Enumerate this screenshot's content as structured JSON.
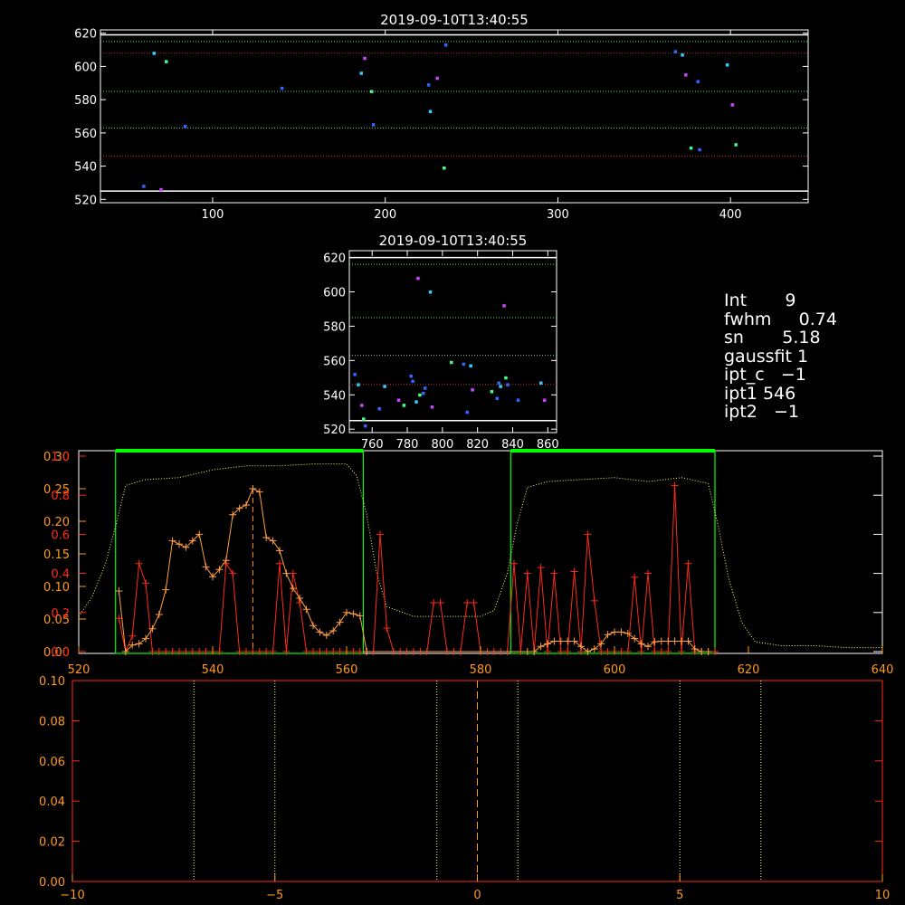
{
  "colors": {
    "background": "#000000",
    "axis_white": "#ffffff",
    "axis_red": "#ff2a1a",
    "axis_orange": "#ff9a1a",
    "data_red": "#ff2a1a",
    "data_orange": "#ffa040",
    "green_band": "#00ff00",
    "guide_green": "#66dd66",
    "guide_red": "#cc3333",
    "guide_yellow": "#ffff66",
    "points_blue": "#3366ff",
    "points_cyan": "#33ccff",
    "points_magenta": "#cc44ff",
    "points_green": "#44ff88"
  },
  "info_panel": [
    {
      "key": "Int",
      "value": "9"
    },
    {
      "key": "fwhm",
      "value": "0.74"
    },
    {
      "key": "sn",
      "value": "5.18"
    },
    {
      "key": "gaussfit",
      "value": "1"
    },
    {
      "key": "ipt_c",
      "value": "−1"
    },
    {
      "key": "ipt1",
      "value": "546"
    },
    {
      "key": "ipt2",
      "value": "−1"
    }
  ],
  "chart_data": [
    {
      "type": "scatter",
      "title": "2019-09-10T13:40:55",
      "xlim": [
        35,
        445
      ],
      "ylim": [
        518,
        622
      ],
      "x_ticks": [
        100,
        200,
        300,
        400
      ],
      "y_ticks": [
        520,
        540,
        560,
        580,
        600,
        620
      ],
      "hlines_white": [
        619,
        525
      ],
      "hlines_green_dotted": [
        615,
        585,
        563
      ],
      "hlines_red_dotted": [
        608,
        546
      ],
      "points": [
        [
          60,
          528
        ],
        [
          66,
          608
        ],
        [
          70,
          526
        ],
        [
          73,
          603
        ],
        [
          84,
          564
        ],
        [
          140,
          587
        ],
        [
          186,
          596
        ],
        [
          188,
          605
        ],
        [
          192,
          585
        ],
        [
          193,
          565
        ],
        [
          225,
          589
        ],
        [
          226,
          573
        ],
        [
          230,
          593
        ],
        [
          234,
          539
        ],
        [
          235,
          613
        ],
        [
          368,
          609
        ],
        [
          372,
          607
        ],
        [
          374,
          595
        ],
        [
          377,
          551
        ],
        [
          381,
          591
        ],
        [
          382,
          550
        ],
        [
          398,
          601
        ],
        [
          401,
          577
        ],
        [
          403,
          553
        ]
      ]
    },
    {
      "type": "scatter",
      "title": "2019-09-10T13:40:55",
      "xlim": [
        747,
        865
      ],
      "ylim": [
        518,
        624
      ],
      "x_ticks": [
        760,
        780,
        800,
        820,
        840,
        860
      ],
      "y_ticks": [
        520,
        540,
        560,
        580,
        600,
        620
      ],
      "hlines_white": [
        620,
        525
      ],
      "hlines_green_dotted": [
        616,
        585,
        563
      ],
      "hlines_red_dotted": [
        546
      ],
      "points": [
        [
          750,
          552
        ],
        [
          752,
          546
        ],
        [
          754,
          534
        ],
        [
          755,
          526
        ],
        [
          756,
          522
        ],
        [
          764,
          532
        ],
        [
          767,
          545
        ],
        [
          775,
          537
        ],
        [
          778,
          534
        ],
        [
          782,
          551
        ],
        [
          783,
          548
        ],
        [
          785,
          536
        ],
        [
          786,
          608
        ],
        [
          787,
          540
        ],
        [
          789,
          541
        ],
        [
          790,
          544
        ],
        [
          793,
          600
        ],
        [
          794,
          533
        ],
        [
          805,
          559
        ],
        [
          812,
          558
        ],
        [
          814,
          530
        ],
        [
          816,
          557
        ],
        [
          817,
          543
        ],
        [
          828,
          542
        ],
        [
          831,
          538
        ],
        [
          832,
          547
        ],
        [
          833,
          545
        ],
        [
          835,
          592
        ],
        [
          836,
          550
        ],
        [
          837,
          546
        ],
        [
          843,
          537
        ],
        [
          856,
          547
        ],
        [
          858,
          537
        ]
      ]
    },
    {
      "type": "line",
      "xlim": [
        520,
        640
      ],
      "x_ticks": [
        520,
        540,
        560,
        580,
        600,
        620,
        640
      ],
      "left_axes": [
        {
          "color": "orange",
          "ticks": [
            "0.00",
            "0.05",
            "0.10",
            "0.15",
            "0.20",
            "0.25",
            "0.30"
          ]
        },
        {
          "color": "red",
          "ticks": [
            "0.0",
            "0.2",
            "0.4",
            "0.6",
            "0.8",
            "1.0"
          ]
        }
      ],
      "green_bands": [
        [
          525.5,
          562.5
        ],
        [
          584.5,
          615
        ]
      ],
      "dashed_marker_x": 546,
      "transmission_profile": {
        "x": [
          520,
          522,
          524,
          525.5,
          527,
          530,
          535,
          540,
          545,
          550,
          555,
          560,
          561.5,
          563,
          564.5,
          566,
          570,
          575,
          580,
          582,
          584,
          585.5,
          587,
          590,
          595,
          600,
          605,
          610,
          614,
          615.5,
          617,
          619,
          621,
          625,
          630,
          635,
          640
        ],
        "y": [
          0.18,
          0.28,
          0.45,
          0.64,
          0.85,
          0.88,
          0.89,
          0.93,
          0.95,
          0.95,
          0.96,
          0.96,
          0.9,
          0.7,
          0.4,
          0.23,
          0.18,
          0.18,
          0.18,
          0.21,
          0.4,
          0.66,
          0.84,
          0.87,
          0.88,
          0.89,
          0.87,
          0.89,
          0.86,
          0.64,
          0.38,
          0.15,
          0.05,
          0.03,
          0.03,
          0.02,
          0.02
        ]
      },
      "series_red": {
        "x": [
          526,
          527,
          528,
          529,
          530,
          531,
          532,
          533,
          534,
          535,
          536,
          537,
          538,
          539,
          540,
          541,
          542,
          543,
          544,
          545,
          546,
          547,
          548,
          549,
          550,
          551,
          552,
          553,
          554,
          555,
          556,
          557,
          558,
          559,
          560,
          561,
          562,
          563,
          564,
          565,
          566,
          567,
          568,
          569,
          570,
          571,
          572,
          573,
          574,
          575,
          576,
          577,
          578,
          579,
          580,
          581,
          582,
          583,
          584,
          585,
          586,
          587,
          588,
          589,
          590,
          591,
          592,
          593,
          594,
          595,
          596,
          597,
          598,
          599,
          600,
          601,
          602,
          603,
          604,
          605,
          606,
          607,
          608,
          609,
          610,
          611,
          612,
          613,
          614,
          615
        ],
        "y": [
          0.17,
          0.0,
          0.08,
          0.45,
          0.35,
          0.0,
          0.0,
          0.0,
          0.0,
          0.0,
          0.0,
          0.0,
          0.0,
          0.0,
          0.0,
          0.0,
          0.45,
          0.4,
          0.0,
          0.0,
          0.0,
          0.0,
          0.0,
          0.0,
          0.45,
          0.0,
          0.4,
          0.25,
          0.0,
          0.0,
          0.0,
          0.0,
          0.0,
          0.0,
          0.0,
          0.0,
          0.0,
          0.0,
          0.0,
          0.6,
          0.12,
          0.0,
          0.0,
          0.0,
          0.0,
          0.0,
          0.0,
          0.25,
          0.25,
          0.0,
          0.0,
          0.0,
          0.25,
          0.25,
          0.0,
          0.0,
          0.0,
          0.0,
          0.0,
          0.45,
          0.0,
          0.4,
          0.0,
          0.43,
          0.0,
          0.4,
          0.0,
          0.0,
          0.41,
          0.0,
          0.6,
          0.26,
          0.0,
          0.0,
          0.0,
          0.0,
          0.0,
          0.38,
          0.0,
          0.4,
          0.0,
          0.0,
          0.0,
          0.85,
          0.0,
          0.45,
          0.0,
          0.0,
          0.0,
          0.0
        ]
      },
      "series_orange": {
        "x": [
          526,
          527,
          528,
          529,
          530,
          531,
          532,
          533,
          534,
          535,
          536,
          537,
          538,
          539,
          540,
          541,
          542,
          543,
          544,
          545,
          546,
          547,
          548,
          549,
          550,
          551,
          552,
          553,
          554,
          555,
          556,
          557,
          558,
          559,
          560,
          561,
          562,
          563,
          587,
          588,
          589,
          590,
          591,
          592,
          593,
          594,
          595,
          596,
          597,
          598,
          599,
          600,
          601,
          602,
          603,
          604,
          605,
          606,
          607,
          608,
          609,
          610,
          611,
          612,
          613,
          614
        ],
        "y": [
          0.093,
          0.0,
          0.01,
          0.012,
          0.02,
          0.035,
          0.057,
          0.095,
          0.17,
          0.165,
          0.16,
          0.17,
          0.18,
          0.13,
          0.115,
          0.126,
          0.14,
          0.21,
          0.22,
          0.225,
          0.25,
          0.245,
          0.175,
          0.17,
          0.155,
          0.12,
          0.097,
          0.082,
          0.065,
          0.04,
          0.03,
          0.025,
          0.032,
          0.045,
          0.06,
          0.058,
          0.055,
          0.0,
          0.0,
          0.0,
          0.008,
          0.012,
          0.016,
          0.016,
          0.016,
          0.016,
          0.008,
          0.0,
          0.004,
          0.012,
          0.026,
          0.03,
          0.03,
          0.028,
          0.02,
          0.012,
          0.008,
          0.015,
          0.016,
          0.016,
          0.016,
          0.016,
          0.016,
          0.004,
          0.0,
          0.0
        ]
      }
    },
    {
      "type": "line",
      "xlim": [
        -10,
        10
      ],
      "ylim": [
        0,
        0.1
      ],
      "x_ticks": [
        -10,
        -5,
        0,
        5,
        10
      ],
      "y_ticks": [
        "0.00",
        "0.02",
        "0.04",
        "0.06",
        "0.08",
        "0.10"
      ],
      "dotted_vlines": [
        -7,
        -5,
        -1,
        1,
        5,
        7
      ],
      "dashed_center_x": 0
    }
  ]
}
